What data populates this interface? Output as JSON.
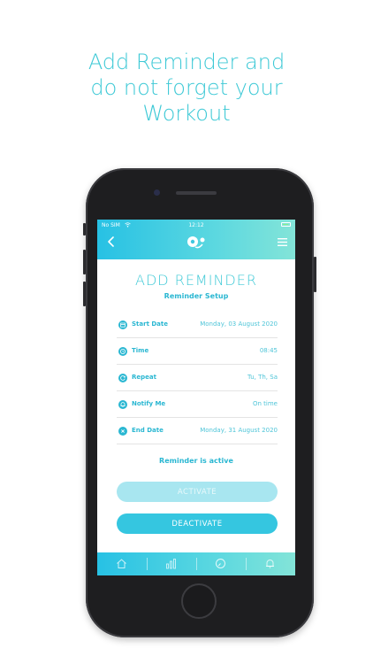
{
  "headline": {
    "line1": "Add Reminder and",
    "line2": "do not forget your",
    "line3": "Workout"
  },
  "status_bar": {
    "carrier": "No SIM",
    "time": "12:12"
  },
  "screen": {
    "title": "ADD REMINDER",
    "subtitle": "Reminder Setup",
    "rows": [
      {
        "label": "Start Date",
        "value": "Monday, 03 August 2020",
        "icon": "calendar-icon"
      },
      {
        "label": "Time",
        "value": "08:45",
        "icon": "clock-icon"
      },
      {
        "label": "Repeat",
        "value": "Tu, Th, Sa",
        "icon": "repeat-icon"
      },
      {
        "label": "Notify Me",
        "value": "On time",
        "icon": "bell-icon"
      },
      {
        "label": "End Date",
        "value": "Monday, 31 August 2020",
        "icon": "close-circle-icon"
      }
    ],
    "status_text": "Reminder is active",
    "activate_label": "ACTIVATE",
    "deactivate_label": "DEACTIVATE"
  },
  "tabbar": {
    "tabs": [
      {
        "icon": "home-icon"
      },
      {
        "icon": "stats-icon"
      },
      {
        "icon": "timer-icon"
      },
      {
        "icon": "bell-icon"
      }
    ]
  },
  "colors": {
    "accent": "#3ec9d6",
    "gradient_start": "#27c1e4",
    "gradient_end": "#83e4d8",
    "button_active": "#35c6e0",
    "button_disabled": "#a8e6f0"
  }
}
